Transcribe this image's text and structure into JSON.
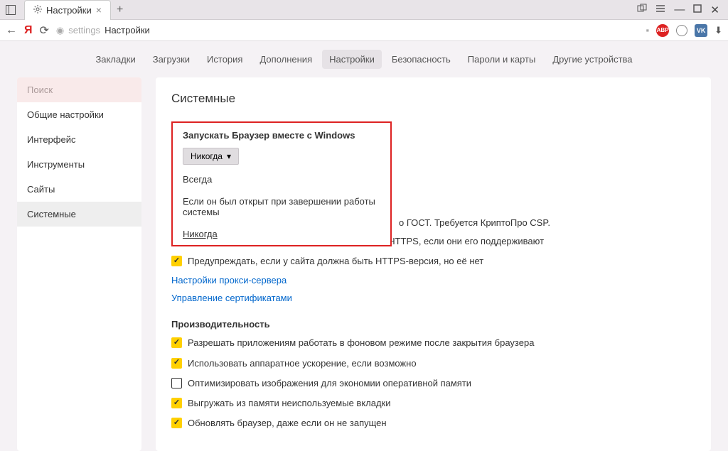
{
  "titlebar": {
    "tab_title": "Настройки",
    "close_glyph": "×",
    "plus_glyph": "+"
  },
  "addrbar": {
    "back_glyph": "←",
    "brand": "Я",
    "reload_glyph": "⟳",
    "secure_glyph": "◉",
    "path1": "settings",
    "path2": "Настройки",
    "bookmark_glyph": "▪",
    "abp": "ABP",
    "vk": "VK",
    "download_glyph": "⬇"
  },
  "topnav": {
    "items": [
      "Закладки",
      "Загрузки",
      "История",
      "Дополнения",
      "Настройки",
      "Безопасность",
      "Пароли и карты",
      "Другие устройства"
    ],
    "active_index": 4
  },
  "sidebar": {
    "search": "Поиск",
    "items": [
      "Общие настройки",
      "Интерфейс",
      "Инструменты",
      "Сайты",
      "Системные"
    ],
    "active_index": 4
  },
  "content": {
    "heading": "Системные",
    "launch_heading": "Запускать Браузер вместе с Windows",
    "dropdown_selected": "Никогда",
    "dropdown_options": [
      "Всегда",
      "Если он был открыт при завершении работы системы",
      "Никогда"
    ],
    "trail_text": "о ГОСТ. Требуется КриптоПро CSP.",
    "rows": [
      {
        "checked": true,
        "label": "Автоматически открывать сайты по протоколу HTTPS, если они его поддерживают"
      },
      {
        "checked": true,
        "label": "Предупреждать, если у сайта должна быть HTTPS-версия, но её нет"
      }
    ],
    "links": [
      "Настройки прокси-сервера",
      "Управление сертификатами"
    ],
    "perf_heading": "Производительность",
    "perf_rows": [
      {
        "checked": true,
        "label": "Разрешать приложениям работать в фоновом режиме после закрытия браузера"
      },
      {
        "checked": true,
        "label": "Использовать аппаратное ускорение, если возможно"
      },
      {
        "checked": false,
        "label": "Оптимизировать изображения для экономии оперативной памяти"
      },
      {
        "checked": true,
        "label": "Выгружать из памяти неиспользуемые вкладки"
      },
      {
        "checked": true,
        "label": "Обновлять браузер, даже если он не запущен"
      }
    ]
  }
}
